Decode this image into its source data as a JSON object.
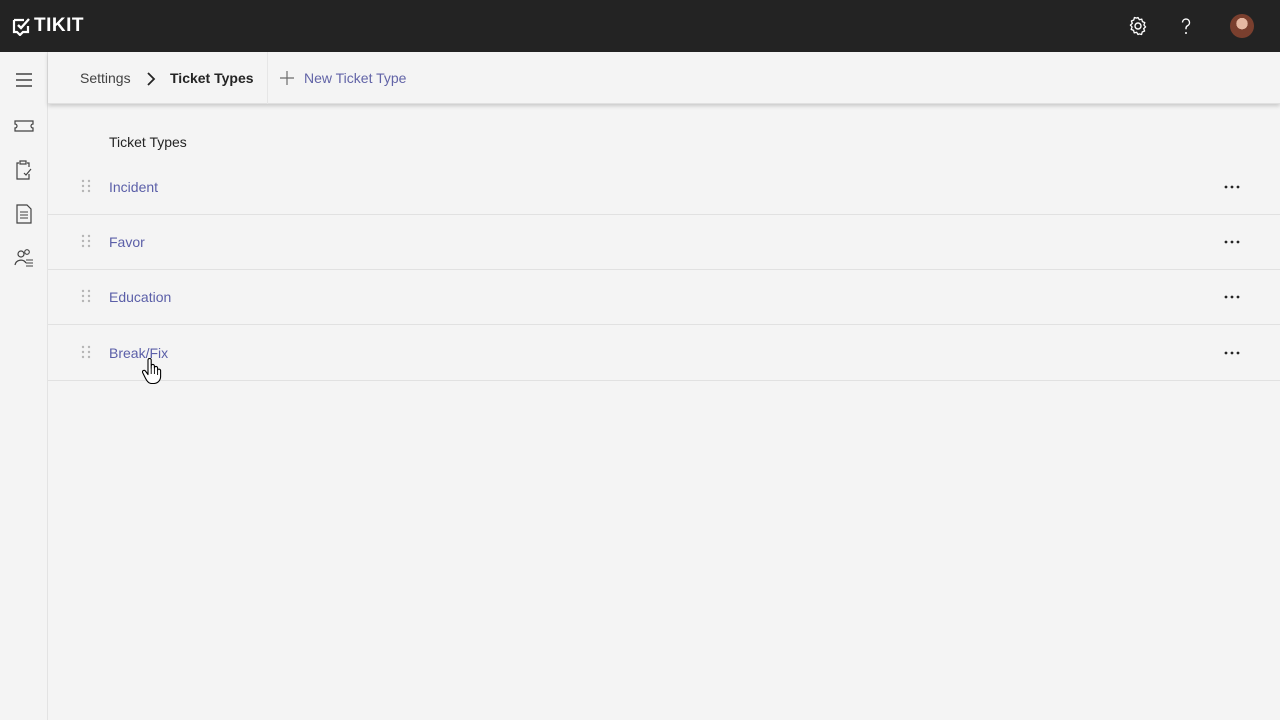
{
  "app": {
    "logo_text": "TIKIT",
    "top_icons": [
      "gear-icon",
      "help-icon",
      "avatar"
    ]
  },
  "left_rail": {
    "items": [
      "hamburger-menu-icon",
      "ticket-icon",
      "clipboard-check-icon",
      "document-icon",
      "people-list-icon"
    ]
  },
  "breadcrumb": {
    "parent": "Settings",
    "current": "Ticket Types"
  },
  "toolbar": {
    "new_label": "New Ticket Type"
  },
  "list": {
    "header": "Ticket Types",
    "items": [
      {
        "label": "Incident"
      },
      {
        "label": "Favor"
      },
      {
        "label": "Education"
      },
      {
        "label": "Break/Fix"
      }
    ]
  },
  "colors": {
    "topbar": "#232323",
    "link": "#5b5fa8",
    "accent": "#6264a7",
    "background": "#f4f4f4"
  }
}
